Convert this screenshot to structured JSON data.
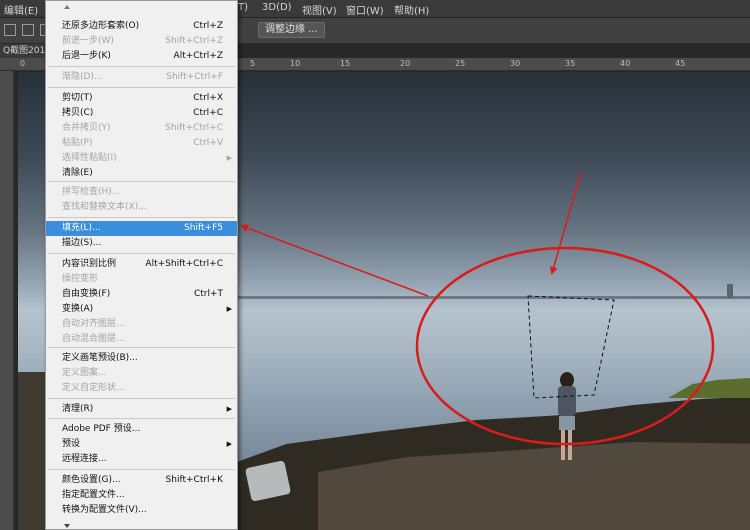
{
  "menubar": {
    "items": [
      "编辑(E)",
      "T)",
      "3D(D)",
      "视图(V)",
      "窗口(W)",
      "帮助(H)"
    ]
  },
  "options_bar": {
    "button_label": "调整边缘 ..."
  },
  "document_tab": {
    "label": "Q截图201"
  },
  "ruler": {
    "labels": [
      "0",
      "5",
      "10",
      "15",
      "20",
      "25",
      "30",
      "35",
      "40",
      "45"
    ]
  },
  "edit_menu": {
    "items": [
      {
        "label": "还原多边形套索(O)",
        "shortcut": "Ctrl+Z",
        "state": "enabled"
      },
      {
        "label": "前进一步(W)",
        "shortcut": "Shift+Ctrl+Z",
        "state": "disabled"
      },
      {
        "label": "后退一步(K)",
        "shortcut": "Alt+Ctrl+Z",
        "state": "enabled"
      },
      {
        "label": "渐隐(D)...",
        "shortcut": "Shift+Ctrl+F",
        "state": "disabled"
      },
      {
        "label": "剪切(T)",
        "shortcut": "Ctrl+X",
        "state": "enabled"
      },
      {
        "label": "拷贝(C)",
        "shortcut": "Ctrl+C",
        "state": "enabled"
      },
      {
        "label": "合并拷贝(Y)",
        "shortcut": "Shift+Ctrl+C",
        "state": "disabled"
      },
      {
        "label": "粘贴(P)",
        "shortcut": "Ctrl+V",
        "state": "disabled"
      },
      {
        "label": "选择性粘贴(I)",
        "shortcut": "",
        "state": "disabled",
        "submenu": true
      },
      {
        "label": "清除(E)",
        "shortcut": "",
        "state": "enabled"
      },
      {
        "label": "拼写检查(H)...",
        "shortcut": "",
        "state": "disabled"
      },
      {
        "label": "查找和替换文本(X)...",
        "shortcut": "",
        "state": "disabled"
      },
      {
        "label": "填充(L)...",
        "shortcut": "Shift+F5",
        "state": "highlighted"
      },
      {
        "label": "描边(S)...",
        "shortcut": "",
        "state": "enabled"
      },
      {
        "label": "内容识别比例",
        "shortcut": "Alt+Shift+Ctrl+C",
        "state": "enabled"
      },
      {
        "label": "操控变形",
        "shortcut": "",
        "state": "disabled"
      },
      {
        "label": "自由变换(F)",
        "shortcut": "Ctrl+T",
        "state": "enabled"
      },
      {
        "label": "变换(A)",
        "shortcut": "",
        "state": "enabled",
        "submenu": true
      },
      {
        "label": "自动对齐图层...",
        "shortcut": "",
        "state": "disabled"
      },
      {
        "label": "自动混合图层...",
        "shortcut": "",
        "state": "disabled"
      },
      {
        "label": "定义画笔预设(B)...",
        "shortcut": "",
        "state": "enabled"
      },
      {
        "label": "定义图案...",
        "shortcut": "",
        "state": "disabled"
      },
      {
        "label": "定义自定形状...",
        "shortcut": "",
        "state": "disabled"
      },
      {
        "label": "清理(R)",
        "shortcut": "",
        "state": "enabled",
        "submenu": true
      },
      {
        "label": "Adobe PDF 预设...",
        "shortcut": "",
        "state": "enabled"
      },
      {
        "label": "预设",
        "shortcut": "",
        "state": "enabled",
        "submenu": true
      },
      {
        "label": "远程连接...",
        "shortcut": "",
        "state": "enabled"
      },
      {
        "label": "颜色设置(G)...",
        "shortcut": "Shift+Ctrl+K",
        "state": "enabled"
      },
      {
        "label": "指定配置文件...",
        "shortcut": "",
        "state": "enabled"
      },
      {
        "label": "转换为配置文件(V)...",
        "shortcut": "",
        "state": "enabled"
      }
    ]
  },
  "annotation": {
    "color": "#d81c1c",
    "shape": "ellipse-with-two-arrows"
  },
  "colors": {
    "menu_highlight": "#3b8edb",
    "annotation_red": "#d81c1c"
  }
}
